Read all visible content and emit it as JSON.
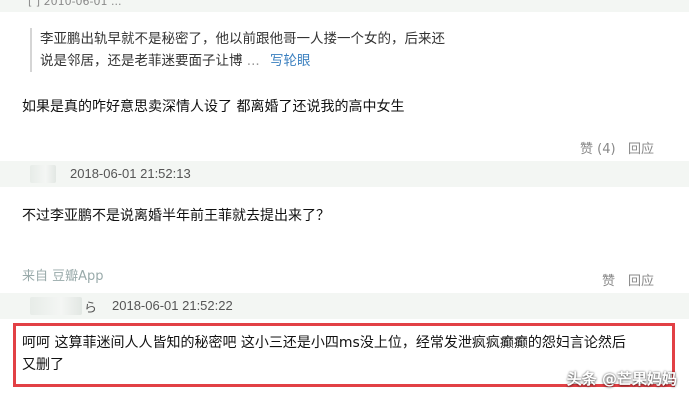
{
  "top_comment": {
    "meta_text": "[  ]  2010-06-01 ...",
    "quote_line1": "李亚鹏出轨早就不是秘密了，他以前跟他哥一人搂一个女的，后来还",
    "quote_line2": "说是邻居，还是老菲迷要面子让博",
    "quote_more": "...",
    "quote_link": "写轮眼",
    "body": "如果是真的咋好意思卖深情人设了 都离婚了还说我的高中女生",
    "like_label": "赞 (4)",
    "reply_label": "回应"
  },
  "second_comment": {
    "time": "2018-06-01 21:52:13",
    "body": "不过李亚鹏不是说离婚半年前王菲就去提出来了？",
    "source": "来自 豆瓣App",
    "like_label": "赞",
    "reply_label": "回应"
  },
  "third_comment": {
    "name_tail": "ら",
    "time": "2018-06-01 21:52:22",
    "body_line1": "呵呵 这算菲迷间人人皆知的秘密吧 这小三还是小四ms没上位，经常发泄疯疯癫癫的怨妇言论然后",
    "body_line2": "又删了"
  },
  "watermark": "头条 @芒果妈妈",
  "colors": {
    "highlight_border": "#e24045",
    "meta_bar": "#f3f6f3",
    "link": "#3a7fbf"
  }
}
